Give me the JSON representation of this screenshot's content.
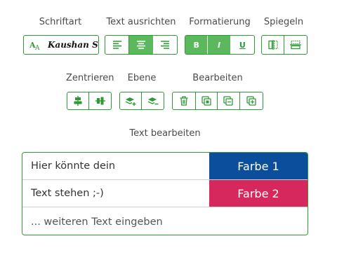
{
  "toolbar": {
    "font": {
      "label": "Schriftart",
      "value": "Kaushan Script"
    },
    "align": {
      "label": "Text ausrichten",
      "buttons": [
        "align-left",
        "align-center",
        "align-right"
      ],
      "active": "align-center"
    },
    "format": {
      "label": "Formatierung",
      "bold": "B",
      "italic": "I",
      "underline": "U",
      "active": [
        "bold",
        "italic"
      ]
    },
    "mirror": {
      "label": "Spiegeln"
    },
    "center": {
      "label": "Zentrieren"
    },
    "layer": {
      "label": "Ebene"
    },
    "edit": {
      "label": "Bearbeiten"
    }
  },
  "text_editor": {
    "heading": "Text bearbeiten",
    "lines": [
      {
        "text": "Hier könnte dein",
        "color_label": "Farbe 1",
        "color": "#0b4f9c"
      },
      {
        "text": "Text stehen ;-)",
        "color_label": "Farbe 2",
        "color": "#d6285d"
      }
    ],
    "placeholder": "... weiteren Text eingeben"
  },
  "colors": {
    "accent": "#2e9a36",
    "active_fill": "#5cb85c"
  }
}
